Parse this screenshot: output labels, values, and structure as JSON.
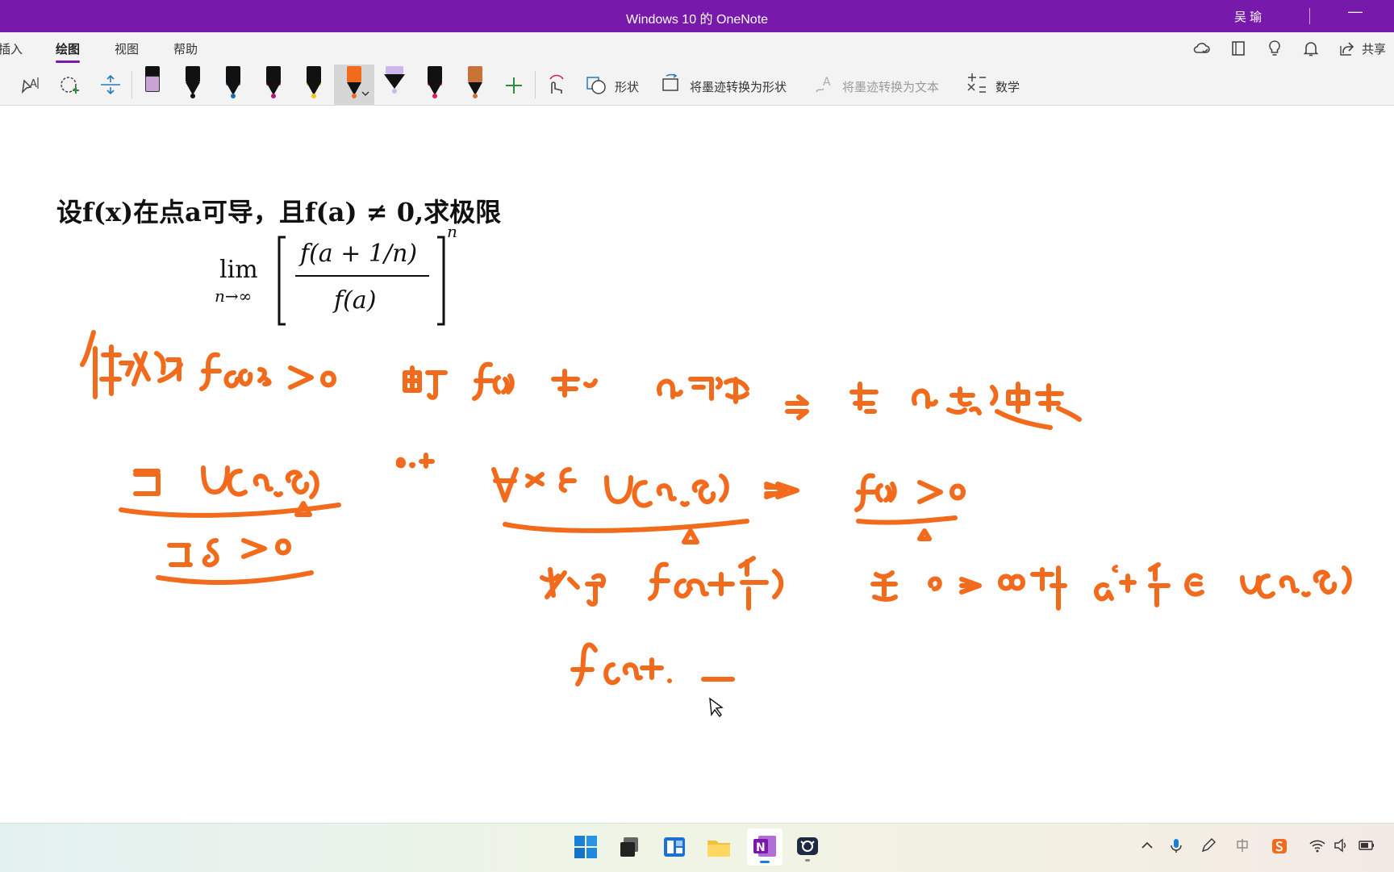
{
  "window": {
    "title": "Windows 10 的 OneNote",
    "user": "吴 瑜",
    "minimize": "—"
  },
  "menu": {
    "tabs": [
      {
        "label": "插入",
        "active": false
      },
      {
        "label": "绘图",
        "active": true
      },
      {
        "label": "视图",
        "active": false
      },
      {
        "label": "帮助",
        "active": false
      }
    ],
    "share_label": "共享"
  },
  "toolbar": {
    "shapes_label": "形状",
    "ink_to_shape_label": "将墨迹转换为形状",
    "ink_to_text_label": "将墨迹转换为文本",
    "math_label": "数学",
    "pens": [
      {
        "color": "#c9a3d6",
        "kind": "highlighter"
      },
      {
        "color": "#111111",
        "kind": "pen"
      },
      {
        "color": "#1b6fb5",
        "kind": "pen"
      },
      {
        "color": "#b0197e",
        "kind": "pen"
      },
      {
        "color": "#f0c419",
        "kind": "pen"
      },
      {
        "color": "#f26b1d",
        "kind": "pen",
        "selected": true
      },
      {
        "color": "#cdb8ee",
        "kind": "highlighter"
      },
      {
        "color": "#e0195b",
        "kind": "pen"
      },
      {
        "color": "#c87238",
        "kind": "pen"
      }
    ]
  },
  "page": {
    "problem_text": "设f(x)在点a可导，且f(a) ≠ 0,求极限",
    "formula": {
      "lim": "lim",
      "lim_sub": "n→∞",
      "numerator": "f(a + 1/n)",
      "denominator": "f(a)",
      "exponent": "n"
    },
    "ink_color": "#f26b1d"
  }
}
